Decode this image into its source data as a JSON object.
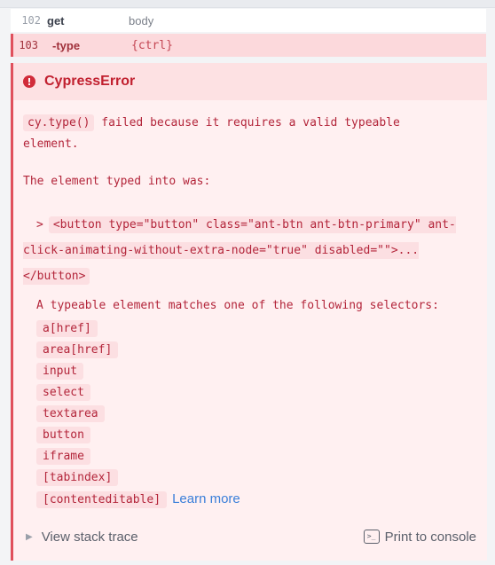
{
  "commands": [
    {
      "number": "102",
      "name": "get",
      "message": "body"
    },
    {
      "number": "103",
      "name": "-type",
      "message": "{ctrl}"
    }
  ],
  "error": {
    "title": "CypressError",
    "command_code": "cy.type()",
    "message_rest_line1": "failed because it requires a valid typeable",
    "message_rest_line2": "element.",
    "typed_into_label": "The element typed into was:",
    "element_prefix": ">",
    "element_html": "<button type=\"button\" class=\"ant-btn ant-btn-primary\" ant-click-animating-without-extra-node=\"true\" disabled=\"\">...</button>",
    "selectors_intro": "A typeable element matches one of the following selectors:",
    "selectors": [
      "a[href]",
      "area[href]",
      "input",
      "select",
      "textarea",
      "button",
      "iframe",
      "[tabindex]",
      "[contenteditable]"
    ],
    "learn_more": "Learn more"
  },
  "footer": {
    "stack_trace": "View stack trace",
    "print_console": "Print to console"
  },
  "colors": {
    "error_red": "#c1202f",
    "error_bg": "#fff0f1",
    "link_blue": "#3a7fd9"
  }
}
